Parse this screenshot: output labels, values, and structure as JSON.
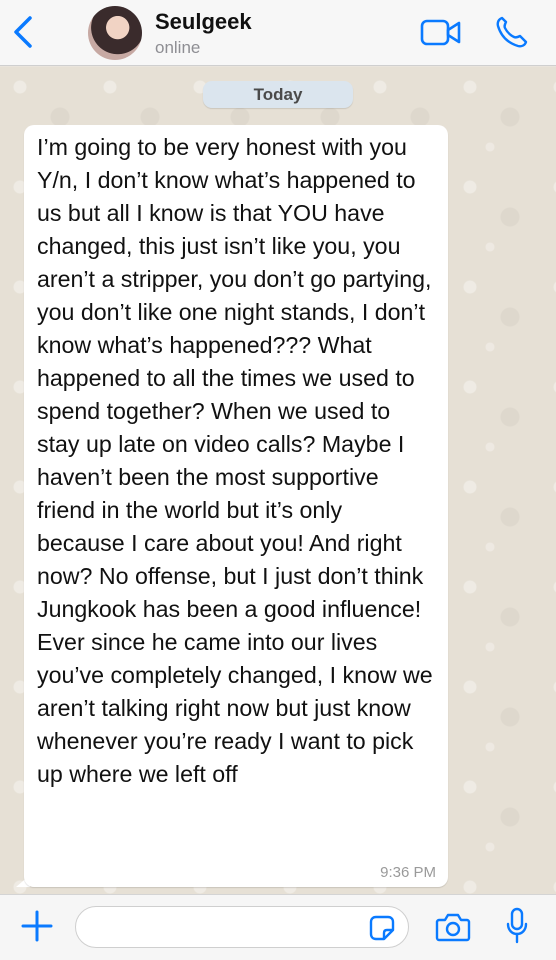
{
  "header": {
    "contact_name": "Seulgeek",
    "status": "online"
  },
  "chat": {
    "date_label": "Today",
    "messages": [
      {
        "direction": "incoming",
        "text": "I’m going to be very honest with you Y/n, I don’t know what’s happened to us but all I know is that YOU have changed, this just isn’t like you, you aren’t a stripper, you don’t go partying, you don’t like one night stands, I don’t know what’s happened??? What happened to all the times we used to spend together? When we used to stay up late on video calls? Maybe I haven’t been the most supportive friend in the world but it’s only because I care about you! And right now? No offense, but I just don’t think Jungkook has been a good influence! Ever since he came into our lives you’ve completely changed, I know we aren’t talking right now but just know whenever you’re ready I want to pick up where we left off",
        "time": "9:36 PM"
      }
    ]
  },
  "input": {
    "value": "",
    "placeholder": ""
  },
  "icons": {
    "back": "chevron-left-icon",
    "video": "video-camera-icon",
    "call": "phone-icon",
    "plus": "plus-icon",
    "sticker": "sticker-icon",
    "camera": "camera-icon",
    "mic": "microphone-icon"
  },
  "colors": {
    "accent": "#0a7aff",
    "bubble": "#ffffff",
    "chat_bg": "#e6e0d5",
    "date_chip": "#dbe5ee"
  }
}
